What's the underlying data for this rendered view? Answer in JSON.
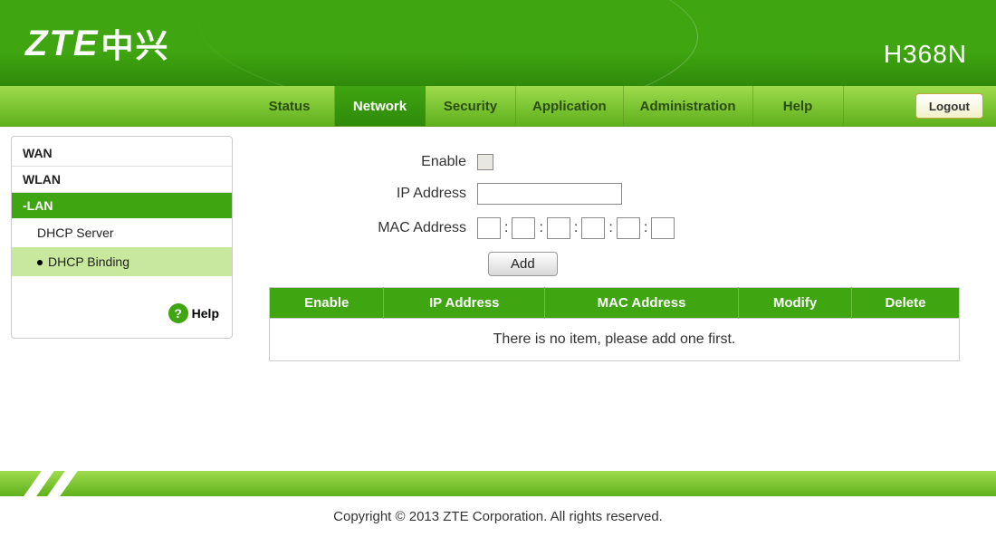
{
  "header": {
    "logo_text": "ZTE",
    "logo_zh": "中兴",
    "model": "H368N"
  },
  "nav": {
    "tabs": [
      "Status",
      "Network",
      "Security",
      "Application",
      "Administration",
      "Help"
    ],
    "active_index": 1,
    "logout_label": "Logout"
  },
  "sidebar": {
    "categories": [
      {
        "label": "WAN",
        "active": false
      },
      {
        "label": "WLAN",
        "active": false
      },
      {
        "label": "-LAN",
        "active": true,
        "children": [
          {
            "label": "DHCP Server",
            "active": false
          },
          {
            "label": "DHCP Binding",
            "active": true
          }
        ]
      }
    ],
    "help_label": "Help"
  },
  "form": {
    "enable_label": "Enable",
    "enable_checked": false,
    "ip_label": "IP Address",
    "ip_value": "",
    "mac_label": "MAC Address",
    "mac_values": [
      "",
      "",
      "",
      "",
      "",
      ""
    ],
    "add_button": "Add"
  },
  "table": {
    "headers": [
      "Enable",
      "IP Address",
      "MAC Address",
      "Modify",
      "Delete"
    ],
    "empty_message": "There is no item, please add one first."
  },
  "footer": {
    "copyright": "Copyright © 2013 ZTE Corporation. All rights reserved."
  }
}
